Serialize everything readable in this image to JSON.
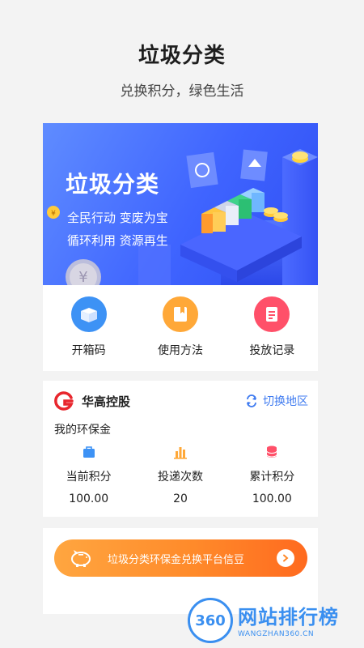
{
  "header": {
    "title": "垃圾分类",
    "subtitle": "兑换积分，绿色生活"
  },
  "banner": {
    "title": "垃圾分类",
    "line1": "全民行动 变废为宝",
    "line2": "循环利用 资源再生"
  },
  "quick_actions": [
    {
      "label": "开箱码",
      "icon": "box-icon",
      "color": "#3d92f5"
    },
    {
      "label": "使用方法",
      "icon": "book-icon",
      "color": "#ffa838"
    },
    {
      "label": "投放记录",
      "icon": "document-icon",
      "color": "#ff5069"
    }
  ],
  "account": {
    "brand": "华高控股",
    "switch_label": "切换地区",
    "section_label": "我的环保金",
    "stats": [
      {
        "label": "当前积分",
        "value": "100.00",
        "icon": "bag-icon",
        "color": "#3d92f5"
      },
      {
        "label": "投递次数",
        "value": "20",
        "icon": "bar-chart-icon",
        "color": "#ffa838"
      },
      {
        "label": "累计积分",
        "value": "100.00",
        "icon": "coin-stack-icon",
        "color": "#ff5069"
      }
    ]
  },
  "promo": {
    "label": "垃圾分类环保金兑换平台信豆",
    "icon": "piggy-bank-icon"
  },
  "watermark": {
    "badge": "360",
    "name": "网站排行榜",
    "url": "WANGZHAN360.CN"
  }
}
